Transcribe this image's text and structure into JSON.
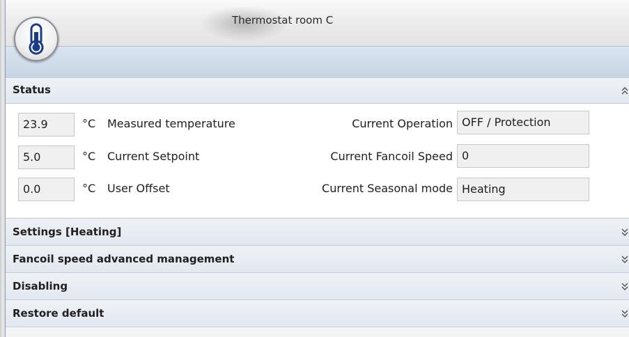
{
  "window": {
    "title": "Thermostat room C"
  },
  "status": {
    "header": "Status",
    "measured_temperature": {
      "value": "23.9",
      "unit": "°C",
      "label": "Measured temperature"
    },
    "current_setpoint": {
      "value": "5.0",
      "unit": "°C",
      "label": "Current Setpoint"
    },
    "user_offset": {
      "value": "0.0",
      "unit": "°C",
      "label": "User Offset"
    },
    "current_operation": {
      "label": "Current Operation",
      "value": "OFF / Protection"
    },
    "current_fancoil_speed": {
      "label": "Current Fancoil Speed",
      "value": "0"
    },
    "current_seasonal_mode": {
      "label": "Current Seasonal mode",
      "value": "Heating"
    }
  },
  "sections": [
    {
      "label": "Settings [Heating]"
    },
    {
      "label": "Fancoil speed advanced management"
    },
    {
      "label": "Disabling"
    },
    {
      "label": "Restore default"
    }
  ],
  "icons": {
    "app_button": "thermometer-icon",
    "collapse": "chevron-double-up-icon",
    "expand": "chevron-double-down-icon"
  },
  "colors": {
    "accent": "#1a3a8c",
    "header_bg": "#e6ecf2",
    "ribbon": "#cfdbe9"
  }
}
